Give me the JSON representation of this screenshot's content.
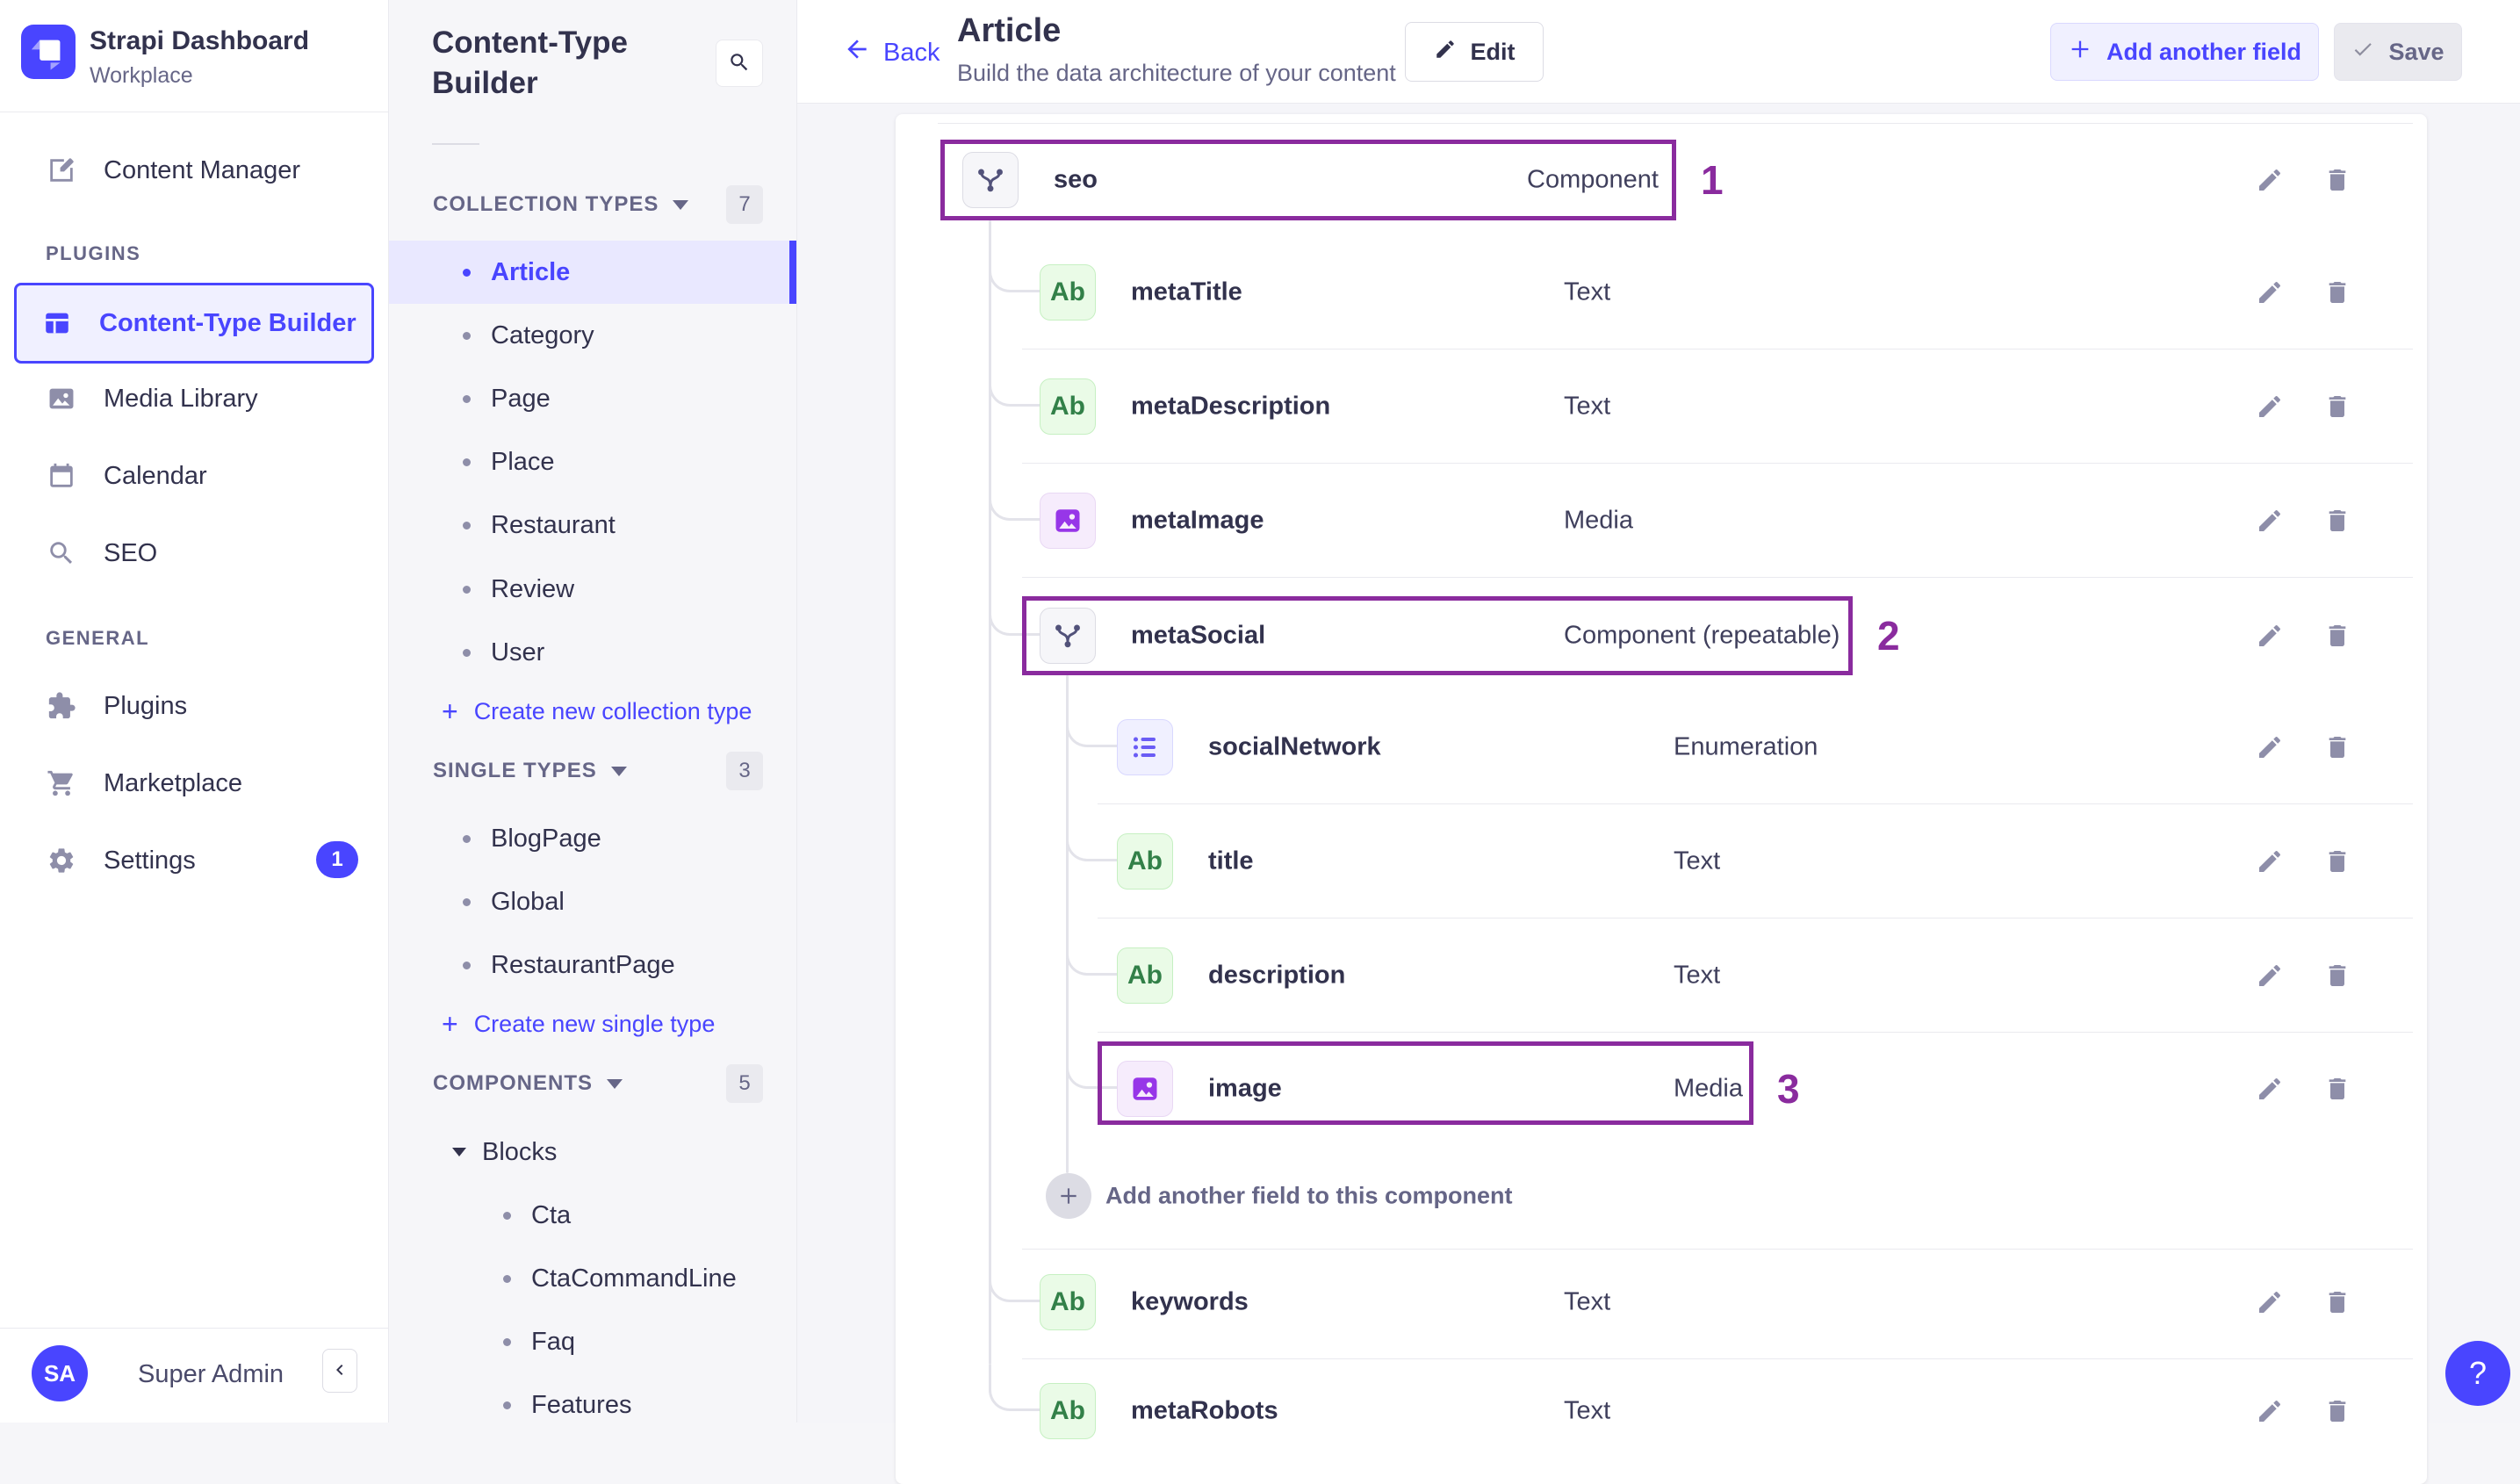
{
  "brand": {
    "name": "Strapi Dashboard",
    "workspace": "Workplace"
  },
  "nav": {
    "content_manager": "Content Manager",
    "plugins_label": "PLUGINS",
    "content_type_builder": "Content-Type Builder",
    "media_library": "Media Library",
    "calendar": "Calendar",
    "seo": "SEO",
    "general_label": "GENERAL",
    "plugins": "Plugins",
    "marketplace": "Marketplace",
    "settings": "Settings",
    "settings_badge": "1",
    "user_initials": "SA",
    "user_name": "Super Admin"
  },
  "subnav": {
    "title": "Content-Type Builder",
    "collection_types": {
      "label": "COLLECTION TYPES",
      "count": "7",
      "items": [
        "Article",
        "Category",
        "Page",
        "Place",
        "Restaurant",
        "Review",
        "User"
      ],
      "create": "Create new collection type"
    },
    "single_types": {
      "label": "SINGLE TYPES",
      "count": "3",
      "items": [
        "BlogPage",
        "Global",
        "RestaurantPage"
      ],
      "create": "Create new single type"
    },
    "components": {
      "label": "COMPONENTS",
      "count": "5",
      "group": "Blocks",
      "items": [
        "Cta",
        "CtaCommandLine",
        "Faq",
        "Features"
      ]
    }
  },
  "header": {
    "back": "Back",
    "title": "Article",
    "subtitle": "Build the data architecture of your content",
    "edit": "Edit",
    "add_field": "Add another field",
    "save": "Save"
  },
  "fields": {
    "text_icon_label": "Ab",
    "add_to_component": "Add another field to this component",
    "rows": [
      {
        "name": "seo",
        "type": "Component"
      },
      {
        "name": "metaTitle",
        "type": "Text"
      },
      {
        "name": "metaDescription",
        "type": "Text"
      },
      {
        "name": "metaImage",
        "type": "Media"
      },
      {
        "name": "metaSocial",
        "type": "Component (repeatable)"
      },
      {
        "name": "socialNetwork",
        "type": "Enumeration"
      },
      {
        "name": "title",
        "type": "Text"
      },
      {
        "name": "description",
        "type": "Text"
      },
      {
        "name": "image",
        "type": "Media"
      },
      {
        "name": "keywords",
        "type": "Text"
      },
      {
        "name": "metaRobots",
        "type": "Text"
      }
    ],
    "annotations": [
      {
        "label": "1"
      },
      {
        "label": "2"
      },
      {
        "label": "3"
      }
    ]
  },
  "help": {
    "label": "?"
  },
  "colors": {
    "accent": "#4945ff",
    "annotation": "#8a2b9e",
    "text_dark": "#32324d",
    "text_muted": "#666687"
  }
}
